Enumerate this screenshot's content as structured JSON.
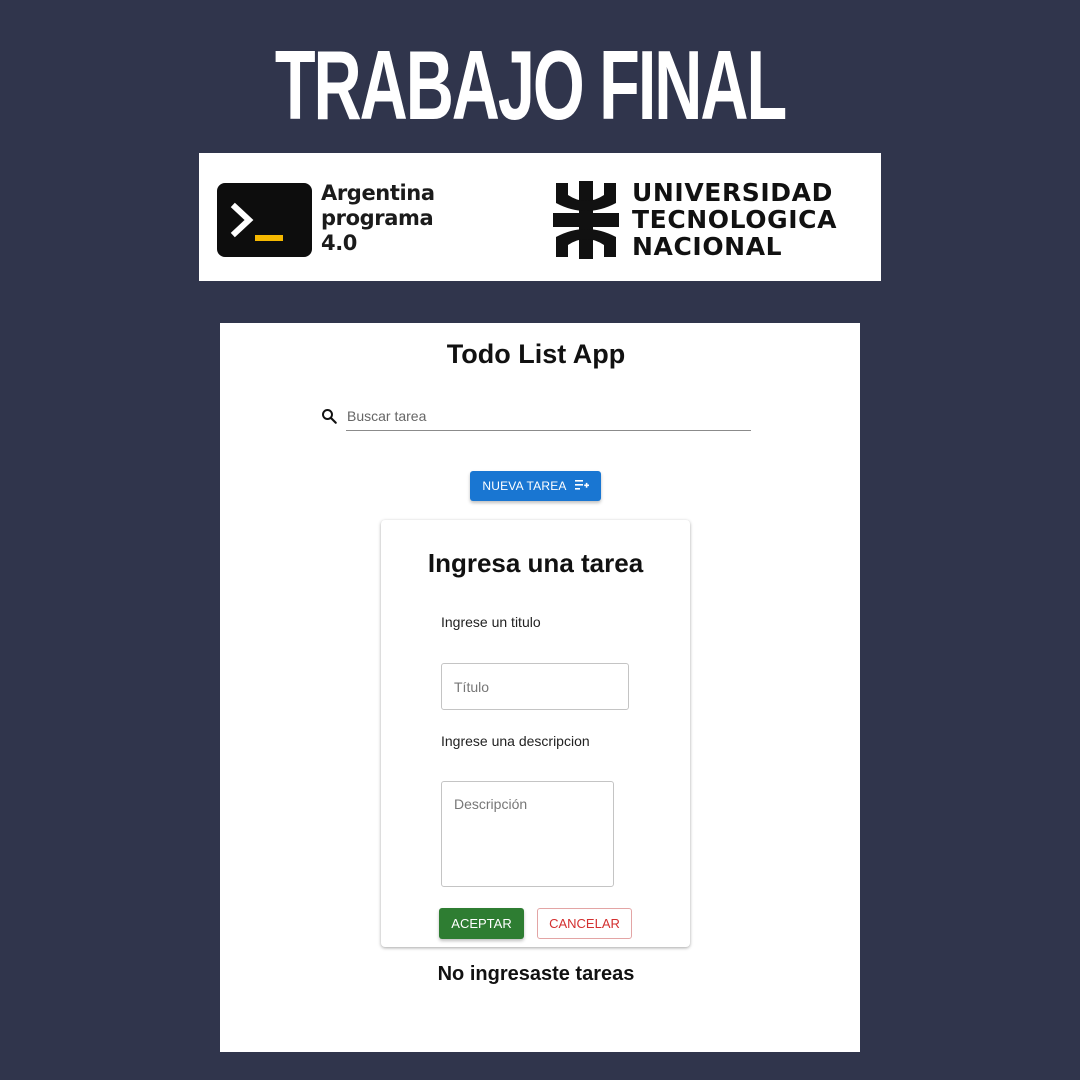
{
  "poster": {
    "title": "TRABAJO FINAL",
    "logos": {
      "argentina_programa": {
        "line1": "Argentina",
        "line2": "programa",
        "line3": "4.0",
        "icon": "terminal-prompt-icon"
      },
      "utn": {
        "line1": "UNIVERSIDAD",
        "line2": "TECNOLOGICA",
        "line3": "NACIONAL",
        "icon": "utn-emblem-icon"
      }
    }
  },
  "app": {
    "title": "Todo List App",
    "search": {
      "placeholder": "Buscar tarea",
      "value": "",
      "icon": "search-icon"
    },
    "new_task_button": {
      "label": "NUEVA TAREA",
      "icon": "playlist-add-icon",
      "color": "#1976d2"
    },
    "form": {
      "heading": "Ingresa una tarea",
      "title_label": "Ingrese un titulo",
      "title_placeholder": "Título",
      "description_label": "Ingrese una descripcion",
      "description_placeholder": "Descripción",
      "accept_label": "ACEPTAR",
      "cancel_label": "CANCELAR",
      "accept_color": "#2e7d32",
      "cancel_color": "#d32f2f"
    },
    "empty_message": "No ingresaste tareas"
  },
  "colors": {
    "background": "#30354c",
    "banner": "#ffffff",
    "accent_yellow": "#f5b800"
  }
}
